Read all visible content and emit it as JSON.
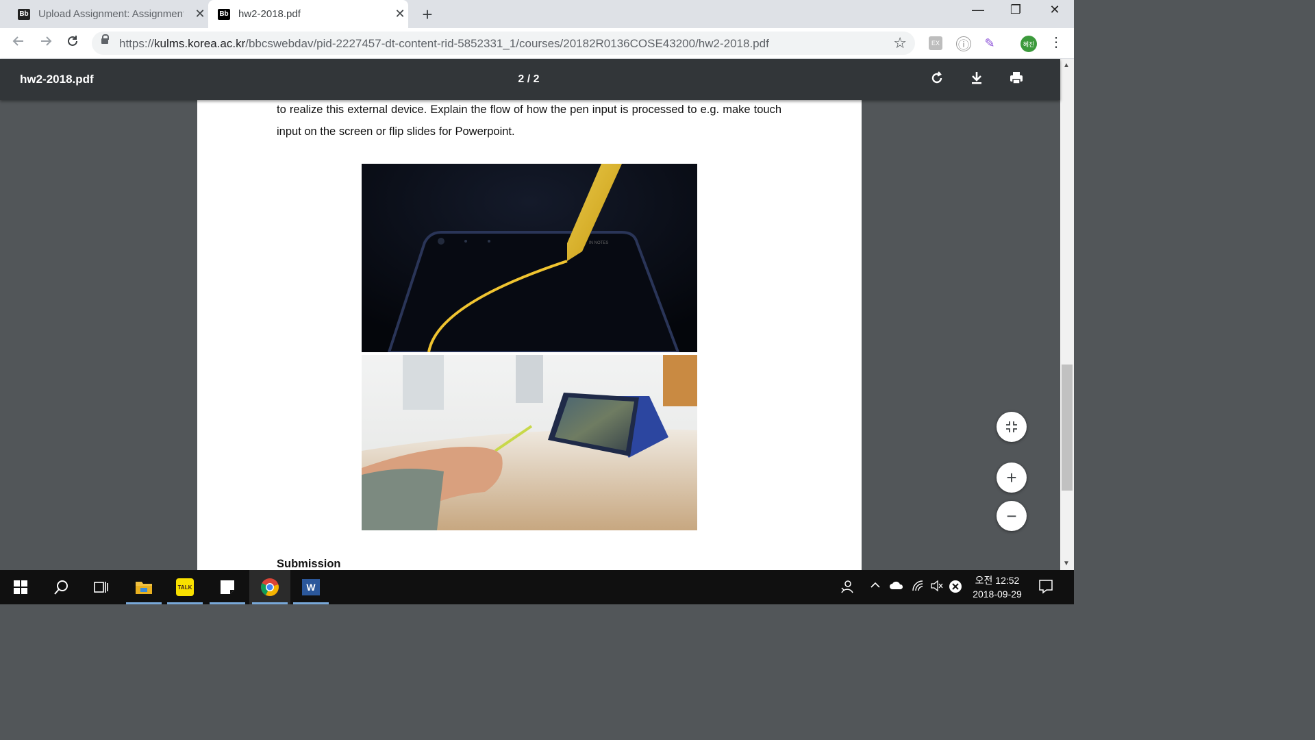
{
  "browser": {
    "tabs": [
      {
        "favicon": "Bb",
        "title": "Upload Assignment: Assignment",
        "active": false,
        "close": "✕"
      },
      {
        "favicon": "Bb",
        "title": "hw2-2018.pdf",
        "active": true,
        "close": "✕"
      }
    ],
    "new_tab": "+",
    "window_controls": {
      "minimize": "—",
      "restore": "❐",
      "close": "✕"
    },
    "url_scheme": "https://",
    "url_host": "kulms.korea.ac.kr",
    "url_path": "/bbcswebdav/pid-2227457-dt-content-rid-5852331_1/courses/20182R0136COSE43200/hw2-2018.pdf",
    "extensions": [
      "EX",
      "ⓘ",
      "✎"
    ],
    "profile": "혜진"
  },
  "pdf_viewer": {
    "title": "hw2-2018.pdf",
    "page_indicator": "2 / 2",
    "icons": [
      "rotate-icon",
      "download-icon",
      "print-icon"
    ]
  },
  "document": {
    "paragraph": "to realize this external device.  Explain the flow of how the pen input is processed to e.g. make touch input on the screen or flip slides for Powerpoint.",
    "phone_label": "IN NOTES",
    "heading": "Submission"
  },
  "zoom": {
    "fit": "⤢",
    "in": "+",
    "out": "−"
  },
  "taskbar": {
    "apps": [
      "start",
      "search",
      "task-view",
      "file-explorer",
      "kakaotalk",
      "sticky-notes",
      "chrome",
      "word"
    ],
    "kakao_label": "TALK",
    "word_label": "W",
    "clock_time": "오전 12:52",
    "clock_date": "2018-09-29"
  }
}
